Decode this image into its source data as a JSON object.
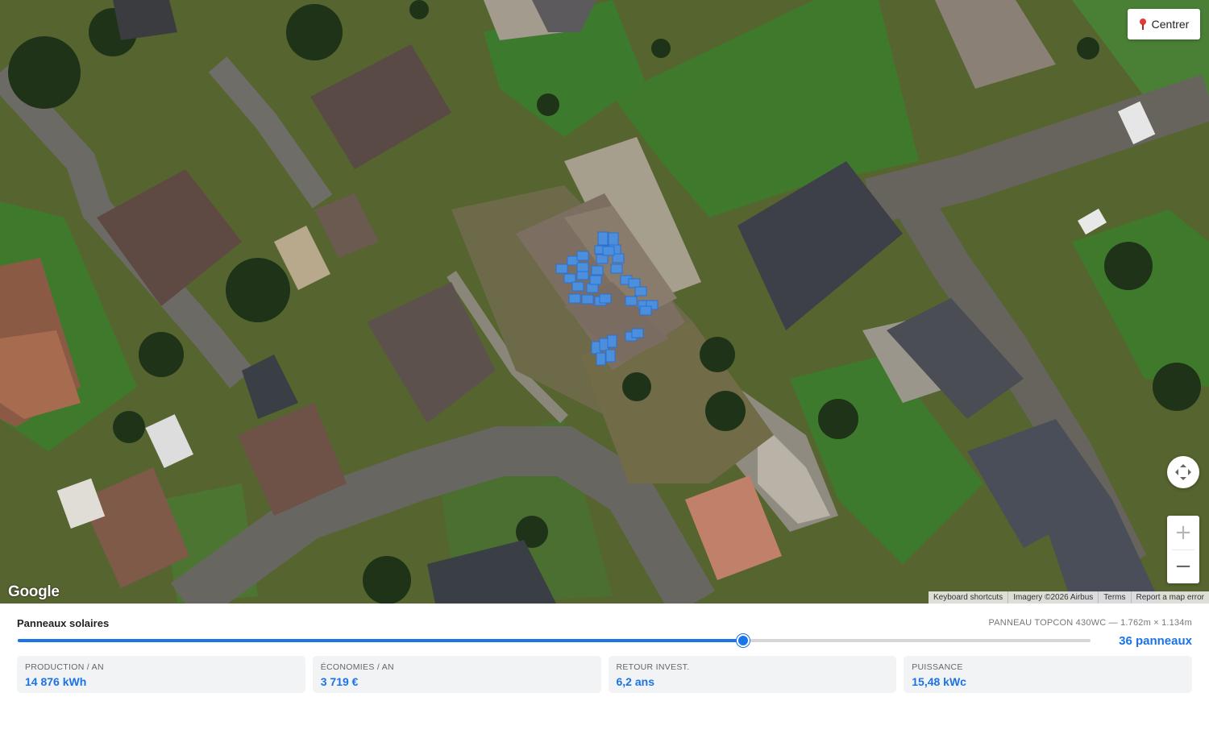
{
  "map": {
    "centrer_label": "Centrer",
    "google_logo": "Google",
    "attribution": [
      "Keyboard shortcuts",
      "Imagery ©2026 Airbus",
      "Terms",
      "Report a map error"
    ],
    "zoom_in": "+",
    "zoom_out": "−",
    "panel_color": "#4a90e2"
  },
  "panel": {
    "title": "Panneaux solaires",
    "model": "PANNEAU TOPCON 430WC — 1.762m × 1.134m",
    "panel_count": "36 panneaux",
    "slider_fraction": 0.676,
    "accent": "#1a73e8",
    "stats": [
      {
        "label": "PRODUCTION / AN",
        "value": "14 876 kWh"
      },
      {
        "label": "ÉCONOMIES / AN",
        "value": "3 719 €"
      },
      {
        "label": "RETOUR INVEST.",
        "value": "6,2 ans"
      },
      {
        "label": "PUISSANCE",
        "value": "15,48 kWc"
      }
    ]
  }
}
